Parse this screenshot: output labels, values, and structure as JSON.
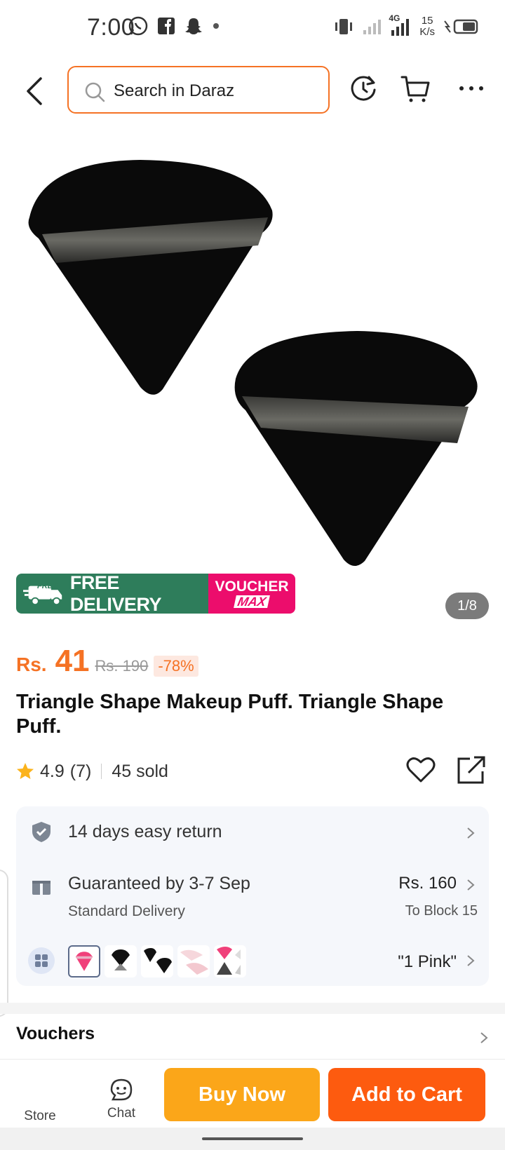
{
  "status_bar": {
    "time": "7:00",
    "network": "4G",
    "speed_value": "15",
    "speed_unit": "K/s"
  },
  "header": {
    "search_placeholder": "Search in Daraz",
    "icons": [
      "back-arrow-icon",
      "search-icon",
      "history-icon",
      "cart-icon",
      "more-icon"
    ],
    "accent_color": "#f57224"
  },
  "gallery": {
    "counter": "1/8",
    "promo_free_delivery": "FREE DELIVERY",
    "promo_free_badge": "FREE",
    "promo_voucher_line1": "VOUCHER",
    "promo_voucher_line2": "MAX"
  },
  "product": {
    "currency": "Rs.",
    "price": "41",
    "original_price": "Rs. 190",
    "discount": "-78%",
    "title": "Triangle Shape Makeup Puff. Triangle Shape Puff.",
    "rating": "4.9",
    "rating_count": "(7)",
    "sold": "45 sold"
  },
  "info": {
    "return_text": "14 days easy return",
    "delivery_text": "Guaranteed by 3-7 Sep",
    "delivery_sub": "Standard Delivery",
    "delivery_price": "Rs. 160",
    "delivery_location": "To Block 15",
    "variant_selected": "\"1 Pink\""
  },
  "vouchers": {
    "label": "Vouchers"
  },
  "bottom_bar": {
    "store_label": "Store",
    "chat_label": "Chat",
    "buy_now": "Buy Now",
    "add_to_cart": "Add to Cart",
    "buy_color": "#fba619",
    "cart_color": "#fd5b0f"
  }
}
